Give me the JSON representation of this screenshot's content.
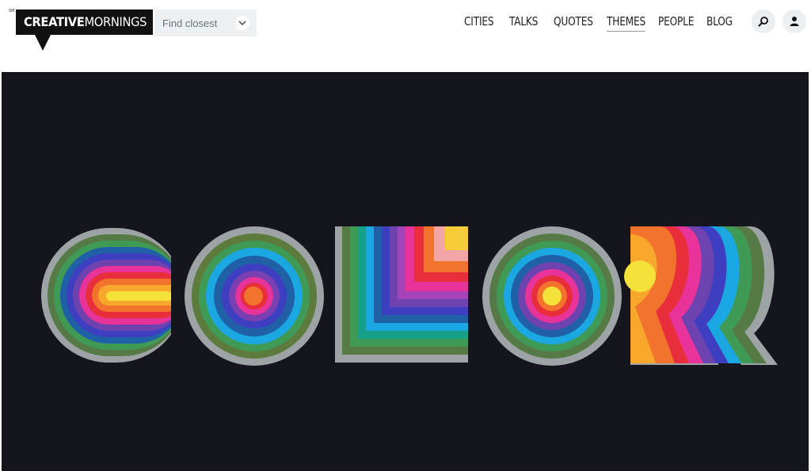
{
  "brand": {
    "trademark": "SM",
    "name_bold": "CREATIVE",
    "name_light": "MORNINGS"
  },
  "city_finder": {
    "placeholder": "Find closest",
    "icon": "chevron-down-icon"
  },
  "nav": {
    "items": [
      {
        "label": "CITIES"
      },
      {
        "label": "TALKS"
      },
      {
        "label": "QUOTES"
      },
      {
        "label": "THEMES",
        "active": true
      },
      {
        "label": "PEOPLE"
      },
      {
        "label": "BLOG"
      }
    ],
    "search_icon": "search-icon",
    "account_icon": "user-icon"
  },
  "hero": {
    "description": "paper-cut rainbow lettering artwork",
    "background_color": "#15161d",
    "palette": [
      "#9ea3a6",
      "#567a45",
      "#3f9a55",
      "#1f60a6",
      "#3d3ec0",
      "#6e43b0",
      "#1aa7e2",
      "#e8339b",
      "#e82e3a",
      "#f2742c",
      "#f7cc3a",
      "#f4e23a"
    ]
  }
}
